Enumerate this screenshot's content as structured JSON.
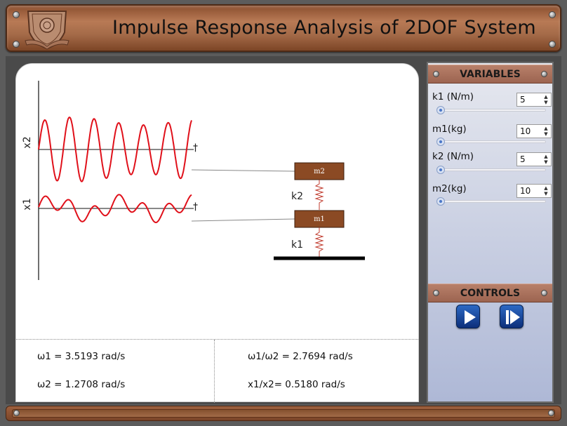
{
  "header": {
    "title": "Impulse Response Analysis of 2DOF System",
    "logo_icon": "institution-seal-icon"
  },
  "plot": {
    "x2_label": "x2",
    "x1_label": "x1",
    "dagger": "†",
    "mass2_label": "m2",
    "mass1_label": "m1",
    "spring2_label": "k2",
    "spring1_label": "k1",
    "curve_color": "#e0101a"
  },
  "results": {
    "w1": "ω1 = 3.5193 rad/s",
    "w2": "ω2 = 1.2708 rad/s",
    "ratio_w": "ω1/ω2 = 2.7694 rad/s",
    "ratio_x": "x1/x2= 0.5180 rad/s"
  },
  "variables": {
    "header": "VARIABLES",
    "items": [
      {
        "label": "k1 (N/m)",
        "value": "5"
      },
      {
        "label": "m1(kg)",
        "value": "10"
      },
      {
        "label": "k2 (N/m)",
        "value": "5"
      },
      {
        "label": "m2(kg)",
        "value": "10"
      }
    ],
    "slider_levels": [
      0,
      0,
      0,
      0
    ]
  },
  "controls": {
    "header": "CONTROLS",
    "play_icon": "play-icon",
    "step_icon": "step-forward-icon"
  }
}
